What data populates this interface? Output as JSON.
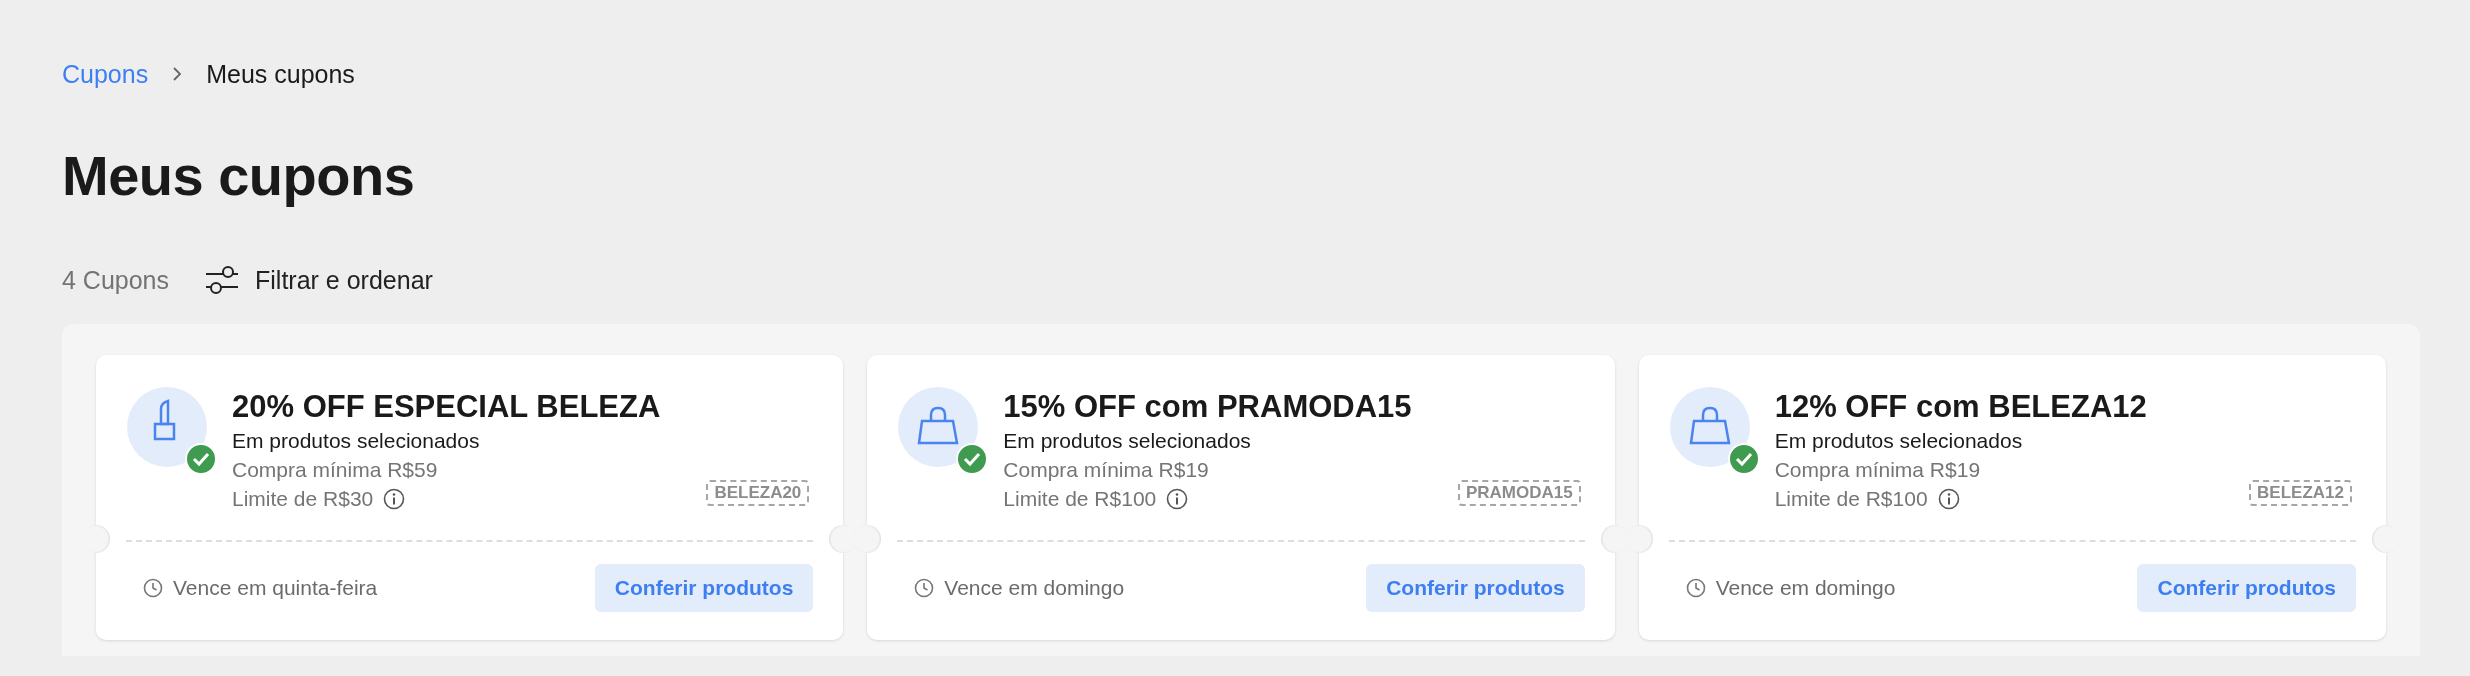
{
  "breadcrumb": [
    {
      "label": "Cupons",
      "kind": "link"
    },
    {
      "label": "Meus cupons",
      "kind": "current"
    }
  ],
  "title": "Meus cupons",
  "toolbar": {
    "count": "4 Cupons",
    "filter": "Filtrar e ordenar"
  },
  "coupons": [
    {
      "kind": "lipstick",
      "checked": true,
      "title": "20% OFF ESPECIAL BELEZA",
      "scope": "Em produtos selecionados",
      "minimum": "Compra mínima R$59",
      "limit": "Limite de R$30",
      "code": "BELEZA20",
      "expires": "Vence em quinta-feira",
      "action": "Conferir produtos"
    },
    {
      "kind": "bag",
      "checked": true,
      "title": "15% OFF com PRAMODA15",
      "scope": "Em produtos selecionados",
      "minimum": "Compra mínima R$19",
      "limit": "Limite de R$100",
      "code": "PRAMODA15",
      "expires": "Vence em domingo",
      "action": "Conferir produtos"
    },
    {
      "kind": "bag",
      "checked": true,
      "title": "12% OFF com BELEZA12",
      "scope": "Em produtos selecionados",
      "minimum": "Compra mínima R$19",
      "limit": "Limite de R$100",
      "code": "BELEZA12",
      "expires": "Vence em domingo",
      "action": "Conferir produtos"
    }
  ]
}
